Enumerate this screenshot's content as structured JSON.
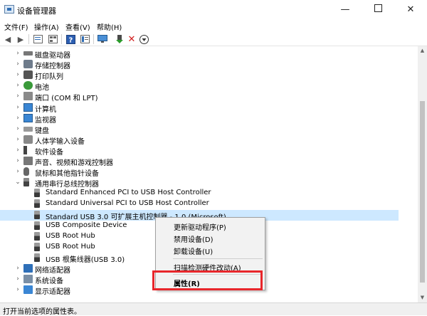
{
  "window": {
    "title": "设备管理器"
  },
  "controls": {
    "minimize": "—",
    "close": "✕"
  },
  "menubar": {
    "items": [
      "文件(F)",
      "操作(A)",
      "查看(V)",
      "帮助(H)"
    ]
  },
  "tree": {
    "items": [
      {
        "label": "磁盘驱动器",
        "icon": "disk-drive-icon",
        "expanded": false
      },
      {
        "label": "存储控制器",
        "icon": "storage-controller-icon",
        "expanded": false
      },
      {
        "label": "打印队列",
        "icon": "printer-icon",
        "expanded": false
      },
      {
        "label": "电池",
        "icon": "battery-icon",
        "expanded": false
      },
      {
        "label": "端口 (COM 和 LPT)",
        "icon": "port-icon",
        "expanded": false
      },
      {
        "label": "计算机",
        "icon": "computer-icon",
        "expanded": false
      },
      {
        "label": "监视器",
        "icon": "monitor-icon",
        "expanded": false
      },
      {
        "label": "键盘",
        "icon": "keyboard-icon",
        "expanded": false
      },
      {
        "label": "人体学输入设备",
        "icon": "hid-icon",
        "expanded": false
      },
      {
        "label": "软件设备",
        "icon": "software-device-icon",
        "expanded": false
      },
      {
        "label": "声音、视频和游戏控制器",
        "icon": "sound-icon",
        "expanded": false
      },
      {
        "label": "鼠标和其他指针设备",
        "icon": "mouse-icon",
        "expanded": false
      },
      {
        "label": "通用串行总线控制器",
        "icon": "usb-controller-icon",
        "expanded": true
      },
      {
        "label": "Standard Enhanced PCI to USB Host Controller",
        "icon": "usb-device-icon",
        "child": true
      },
      {
        "label": "Standard Universal PCI to USB Host Controller",
        "icon": "usb-device-icon",
        "child": true
      },
      {
        "label": "Standard USB 3.0 可扩展主机控制器 - 1.0 (Microsoft)",
        "icon": "usb-device-icon",
        "child": true,
        "selected": true
      },
      {
        "label": "USB Composite Device",
        "icon": "usb-device-icon",
        "child": true
      },
      {
        "label": "USB Root Hub",
        "icon": "usb-device-icon",
        "child": true
      },
      {
        "label": "USB Root Hub",
        "icon": "usb-device-icon",
        "child": true
      },
      {
        "label": "USB 根集线器(USB 3.0)",
        "icon": "usb-device-icon",
        "child": true
      },
      {
        "label": "网络适配器",
        "icon": "network-adapter-icon",
        "expanded": false
      },
      {
        "label": "系统设备",
        "icon": "system-device-icon",
        "expanded": false
      },
      {
        "label": "显示适配器",
        "icon": "display-adapter-icon",
        "expanded": false
      }
    ]
  },
  "context_menu": {
    "items": [
      {
        "label": "更新驱动程序(P)"
      },
      {
        "label": "禁用设备(D)"
      },
      {
        "label": "卸载设备(U)"
      },
      {
        "label": "扫描检测硬件改动(A)"
      },
      {
        "label": "属性(R)",
        "bold": true
      }
    ]
  },
  "status": {
    "text": "打开当前选项的属性表。"
  },
  "colors": {
    "highlight": "#e8262b",
    "selection": "#cde8ff",
    "menu_bg": "#f2f2f2"
  }
}
